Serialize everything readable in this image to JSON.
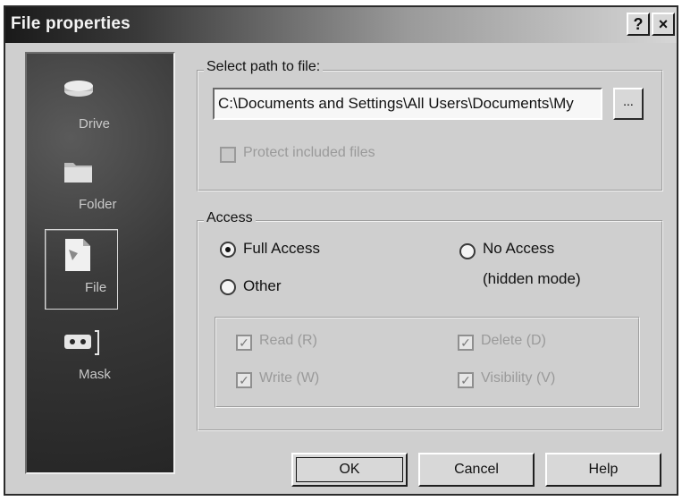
{
  "window": {
    "title": "File properties",
    "help_label": "?",
    "close_label": "×"
  },
  "sidebar": {
    "items": [
      {
        "label": "Drive",
        "icon": "drive-icon"
      },
      {
        "label": "Folder",
        "icon": "folder-icon"
      },
      {
        "label": "File",
        "icon": "file-icon",
        "selected": true
      },
      {
        "label": "Mask",
        "icon": "mask-icon"
      }
    ]
  },
  "path_group": {
    "legend": "Select path to file:",
    "path_value": "C:\\Documents and Settings\\All Users\\Documents\\My",
    "browse_label": "...",
    "protect_label": "Protect included files",
    "protect_checked": false
  },
  "access_group": {
    "legend": "Access",
    "full_access_label": "Full Access",
    "full_access_selected": true,
    "other_label": "Other",
    "no_access_label": "No Access",
    "no_access_note": "(hidden mode)",
    "permissions": [
      {
        "label": "Read (R)",
        "checked": true
      },
      {
        "label": "Delete (D)",
        "checked": true
      },
      {
        "label": "Write (W)",
        "checked": true
      },
      {
        "label": "Visibility (V)",
        "checked": true
      }
    ]
  },
  "buttons": {
    "ok": "OK",
    "cancel": "Cancel",
    "help": "Help"
  }
}
